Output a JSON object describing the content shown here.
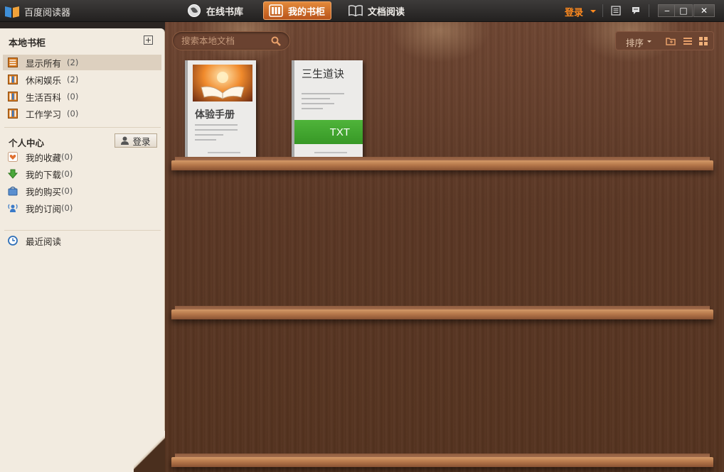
{
  "app": {
    "title": "百度阅读器"
  },
  "tabs": [
    {
      "label": "在线书库",
      "icon": "globe-icon"
    },
    {
      "label": "我的书柜",
      "icon": "bookshelf-icon",
      "active": true
    },
    {
      "label": "文档阅读",
      "icon": "open-book-icon"
    }
  ],
  "topbar": {
    "login_label": "登录",
    "icons": [
      "list-icon",
      "chat-bubble-icon"
    ],
    "window": [
      "minimize",
      "maximize",
      "close"
    ]
  },
  "window_controls": {
    "minimize": "‒",
    "maximize": "□",
    "close": "✕"
  },
  "sidebar": {
    "local_title": "本地书柜",
    "local_items": [
      {
        "label": "显示所有",
        "count": "(2)",
        "selected": true
      },
      {
        "label": "休闲娱乐",
        "count": "(2)"
      },
      {
        "label": "生活百科",
        "count": "(0)"
      },
      {
        "label": "工作学习",
        "count": "(0)"
      }
    ],
    "personal_title": "个人中心",
    "login_label": "登录",
    "personal_items": [
      {
        "label": "我的收藏",
        "count": "(0)",
        "icon": "heart-icon"
      },
      {
        "label": "我的下载",
        "count": "(0)",
        "icon": "download-arrow-icon"
      },
      {
        "label": "我的购买",
        "count": "(0)",
        "icon": "shopping-bag-icon"
      },
      {
        "label": "我的订阅",
        "count": "(0)",
        "icon": "subscription-icon"
      }
    ],
    "recent_label": "最近阅读"
  },
  "search": {
    "placeholder": "搜索本地文档"
  },
  "toolbar": {
    "sort_label": "排序"
  },
  "books": [
    {
      "title": "体验手册"
    },
    {
      "title": "三生道诀",
      "format": "TXT"
    }
  ],
  "colors": {
    "accent": "#ff8a1f",
    "tab_active": "#d16f2a",
    "txt_band": "#44a832",
    "wood": "#5c3825"
  }
}
